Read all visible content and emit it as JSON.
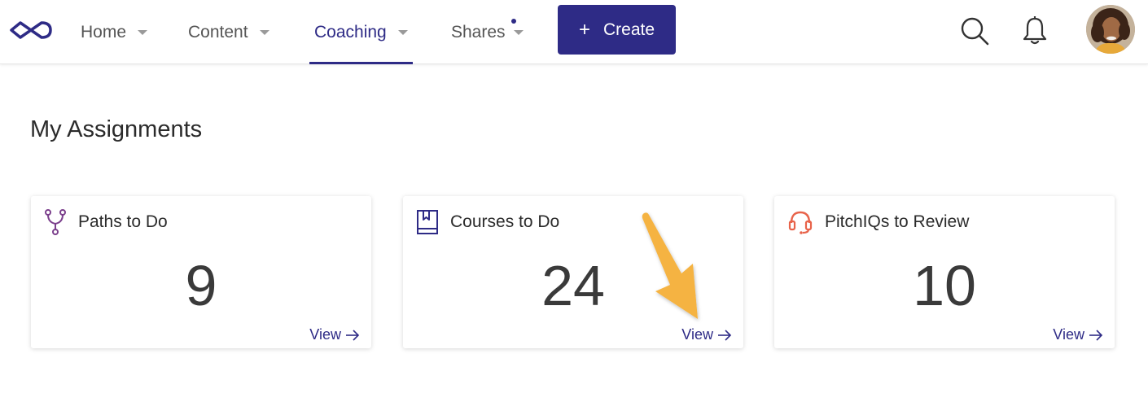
{
  "nav": {
    "items": [
      {
        "label": "Home",
        "active": false
      },
      {
        "label": "Content",
        "active": false
      },
      {
        "label": "Coaching",
        "active": true
      },
      {
        "label": "Shares",
        "active": false,
        "has_notification": true
      }
    ],
    "create_label": "Create",
    "icons": [
      "infinity-logo-icon",
      "search-icon",
      "bell-icon",
      "avatar"
    ]
  },
  "page": {
    "title": "My Assignments"
  },
  "cards": [
    {
      "title": "Paths to Do",
      "count": "9",
      "view_label": "View",
      "icon": "path-fork-icon",
      "icon_color": "#7b3f8c"
    },
    {
      "title": "Courses to Do",
      "count": "24",
      "view_label": "View",
      "icon": "book-icon",
      "icon_color": "#2e2b86"
    },
    {
      "title": "PitchIQs to Review",
      "count": "10",
      "view_label": "View",
      "icon": "headset-icon",
      "icon_color": "#e8634a"
    }
  ],
  "colors": {
    "brand": "#2e2b86",
    "callout_arrow": "#f5b342"
  }
}
